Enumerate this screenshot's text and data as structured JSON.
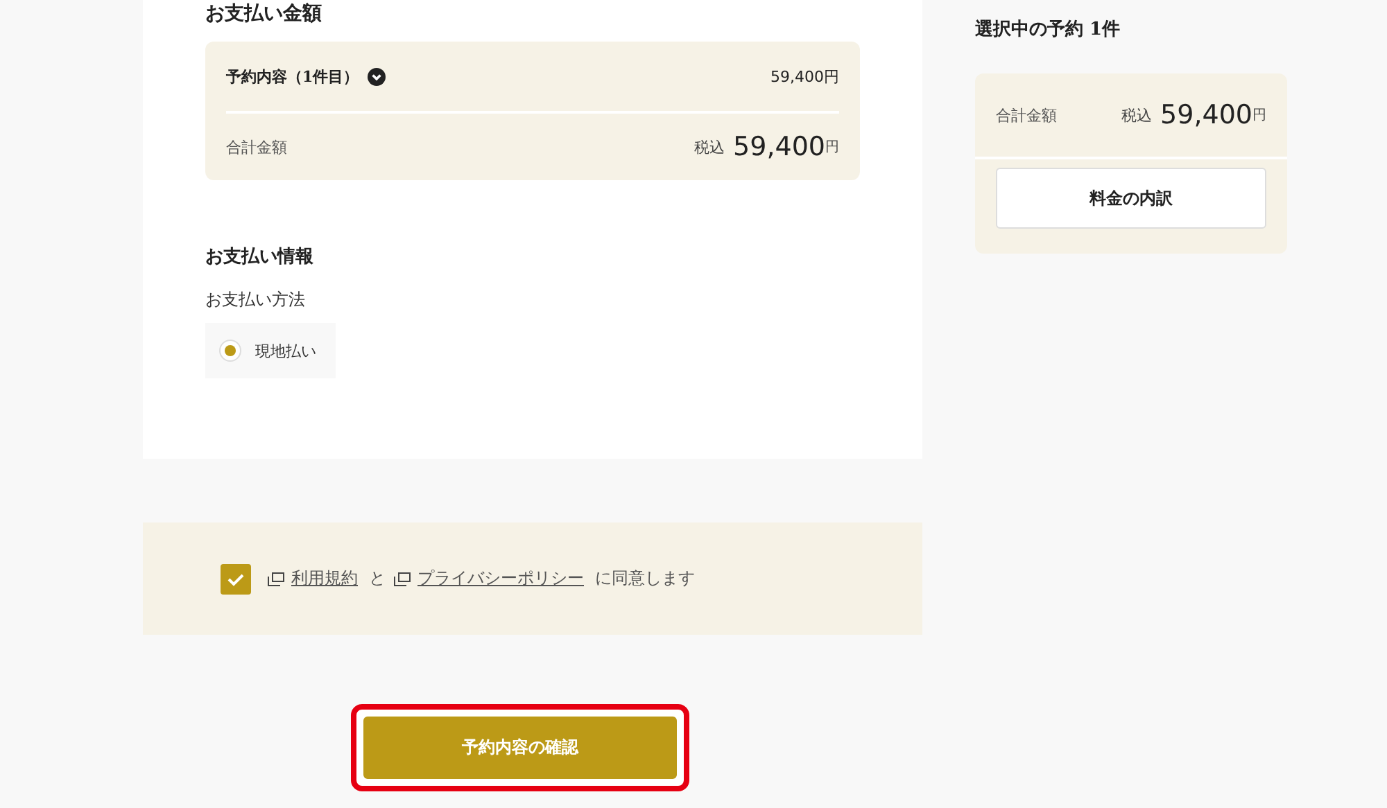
{
  "payment_amount": {
    "heading": "お支払い金額",
    "item": {
      "label": "予約内容（1件目）",
      "expanded": false,
      "amount": "59,400円"
    },
    "total": {
      "label": "合計金額",
      "tax_label": "税込",
      "amount": "59,400",
      "unit": "円"
    }
  },
  "payment_info": {
    "heading": "お支払い情報",
    "method_label": "お支払い方法",
    "options": [
      {
        "label": "現地払い",
        "selected": true
      }
    ]
  },
  "agreement": {
    "checked": true,
    "parts": [
      {
        "kind": "link",
        "text": "利用規約"
      },
      {
        "kind": "text",
        "text": "と"
      },
      {
        "kind": "link",
        "text": "プライバシーポリシー"
      },
      {
        "kind": "text",
        "text": "に同意します"
      }
    ]
  },
  "confirm_button": {
    "label": "予約内容の確認",
    "highlighted": true
  },
  "summary": {
    "heading": "選択中の予約 1件",
    "total_label": "合計金額",
    "tax_label": "税込",
    "amount": "59,400",
    "unit": "円",
    "breakdown_button": "料金の内訳"
  }
}
